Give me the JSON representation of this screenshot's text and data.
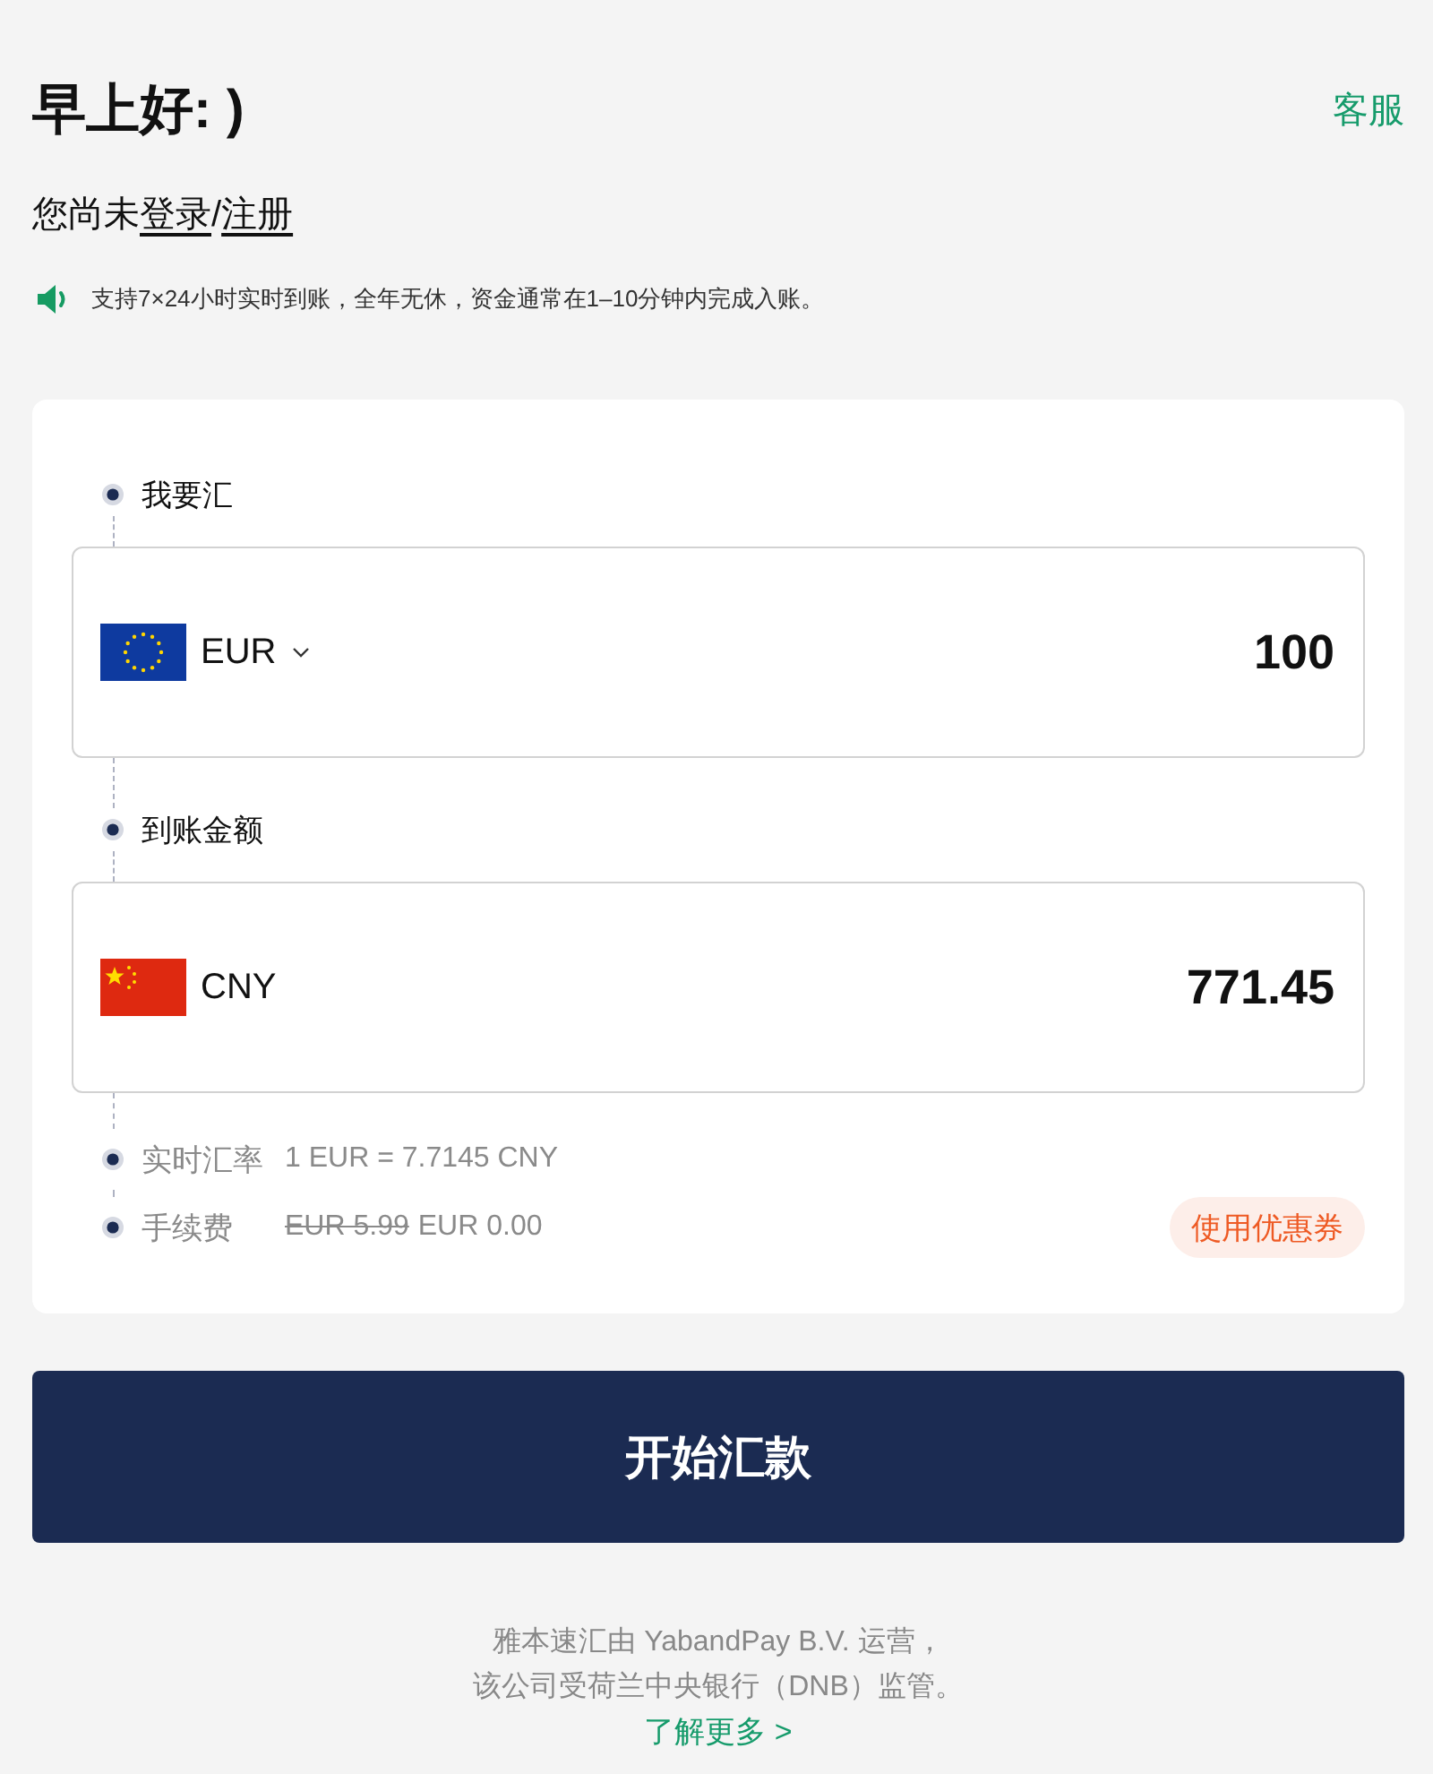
{
  "header": {
    "greeting": "早上好: )",
    "support_link": "客服"
  },
  "login_prompt": {
    "text": "您尚未",
    "login_link": "登录",
    "separator": "/",
    "register_link": "注册"
  },
  "notice": {
    "text": "支持7×24小时实时到账，全年无休，资金通常在1–10分钟内完成入账。"
  },
  "converter": {
    "legs": [
      {
        "label": "我要汇",
        "kind": "eu",
        "currency": "EUR",
        "dropdown": true,
        "amount": "100"
      },
      {
        "label": "到账金额",
        "kind": "cn",
        "currency": "CNY",
        "dropdown": false,
        "amount": "771.45"
      }
    ],
    "details": [
      {
        "label": "实时汇率",
        "value": "1 EUR = 7.7145 CNY"
      },
      {
        "label": "手续费",
        "old_value": "EUR 5.99",
        "value": "EUR 0.00",
        "action": "使用优惠券"
      }
    ]
  },
  "submit_button": "开始汇款",
  "footer": {
    "lines": [
      "雅本速汇由 YabandPay B.V. 运营，",
      "该公司受荷兰中央银行（DNB）监管。"
    ],
    "learn_more_link": "了解更多 >"
  }
}
